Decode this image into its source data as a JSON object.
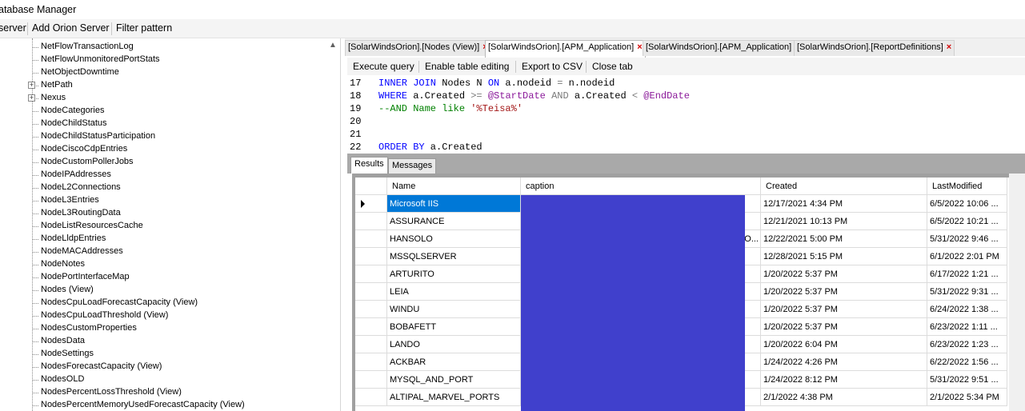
{
  "window": {
    "title": "atabase Manager"
  },
  "toolbar": {
    "items": [
      "server",
      "Add Orion Server",
      "Filter pattern"
    ]
  },
  "tree": {
    "items": [
      {
        "label": "NetFlowTransactionLog",
        "expandable": false
      },
      {
        "label": "NetFlowUnmonitoredPortStats",
        "expandable": false
      },
      {
        "label": "NetObjectDowntime",
        "expandable": false
      },
      {
        "label": "NetPath",
        "expandable": true
      },
      {
        "label": "Nexus",
        "expandable": true
      },
      {
        "label": "NodeCategories",
        "expandable": false
      },
      {
        "label": "NodeChildStatus",
        "expandable": false
      },
      {
        "label": "NodeChildStatusParticipation",
        "expandable": false
      },
      {
        "label": "NodeCiscoCdpEntries",
        "expandable": false
      },
      {
        "label": "NodeCustomPollerJobs",
        "expandable": false
      },
      {
        "label": "NodeIPAddresses",
        "expandable": false
      },
      {
        "label": "NodeL2Connections",
        "expandable": false
      },
      {
        "label": "NodeL3Entries",
        "expandable": false
      },
      {
        "label": "NodeL3RoutingData",
        "expandable": false
      },
      {
        "label": "NodeListResourcesCache",
        "expandable": false
      },
      {
        "label": "NodeLldpEntries",
        "expandable": false
      },
      {
        "label": "NodeMACAddresses",
        "expandable": false
      },
      {
        "label": "NodeNotes",
        "expandable": false
      },
      {
        "label": "NodePortInterfaceMap",
        "expandable": false
      },
      {
        "label": "Nodes (View)",
        "expandable": false
      },
      {
        "label": "NodesCpuLoadForecastCapacity (View)",
        "expandable": false
      },
      {
        "label": "NodesCpuLoadThreshold (View)",
        "expandable": false
      },
      {
        "label": "NodesCustomProperties",
        "expandable": false
      },
      {
        "label": "NodesData",
        "expandable": false
      },
      {
        "label": "NodeSettings",
        "expandable": false
      },
      {
        "label": "NodesForecastCapacity (View)",
        "expandable": false
      },
      {
        "label": "NodesOLD",
        "expandable": false
      },
      {
        "label": "NodesPercentLossThreshold (View)",
        "expandable": false
      },
      {
        "label": "NodesPercentMemoryUsedForecastCapacity (View)",
        "expandable": false
      }
    ],
    "scroll_icon": "chevron-up-icon",
    "expand_glyph": "+"
  },
  "tabs": [
    {
      "label": "[SolarWindsOrion].[Nodes (View)]",
      "active": false
    },
    {
      "label": "[SolarWindsOrion].[APM_Application]",
      "active": true
    },
    {
      "label": "[SolarWindsOrion].[APM_Application]",
      "active": false
    },
    {
      "label": "[SolarWindsOrion].[ReportDefinitions]",
      "active": false
    }
  ],
  "tab_close_glyph": "×",
  "query_toolbar": {
    "execute": "Execute query",
    "enable_edit": "Enable table editing",
    "export_csv": "Export to CSV",
    "close_tab": "Close tab"
  },
  "editor": {
    "lines": [
      {
        "n": "17",
        "tokens": [
          [
            "kw",
            "INNER JOIN"
          ],
          [
            "t",
            " Nodes N "
          ],
          [
            "kw",
            "ON"
          ],
          [
            "t",
            " a.nodeid "
          ],
          [
            "op",
            "="
          ],
          [
            "t",
            " n.nodeid"
          ]
        ]
      },
      {
        "n": "18",
        "tokens": [
          [
            "kw",
            "WHERE"
          ],
          [
            "t",
            " a.Created "
          ],
          [
            "op",
            ">="
          ],
          [
            "t",
            " "
          ],
          [
            "var",
            "@StartDate"
          ],
          [
            "t",
            " "
          ],
          [
            "op",
            "AND"
          ],
          [
            "t",
            " a.Created "
          ],
          [
            "op",
            "<"
          ],
          [
            "t",
            " "
          ],
          [
            "var",
            "@EndDate"
          ]
        ]
      },
      {
        "n": "19",
        "tokens": [
          [
            "cmt",
            "--AND Name like "
          ],
          [
            "str",
            "'%Teisa%'"
          ]
        ]
      },
      {
        "n": "20",
        "tokens": []
      },
      {
        "n": "21",
        "tokens": []
      },
      {
        "n": "22",
        "tokens": [
          [
            "kw",
            "ORDER BY"
          ],
          [
            "t",
            " a.Created"
          ]
        ]
      }
    ]
  },
  "result_tabs": [
    {
      "label": "Results",
      "active": true
    },
    {
      "label": "Messages",
      "active": false
    }
  ],
  "grid": {
    "columns": [
      "Name",
      "caption",
      "Created",
      "LastModified"
    ],
    "current_row_icon": "row-pointer-icon",
    "rows": [
      {
        "name": "Microsoft IIS",
        "caption": "",
        "created": "12/17/2021 4:34 PM",
        "modified": "6/5/2022 10:06 ...",
        "selected": true
      },
      {
        "name": "ASSURANCE",
        "caption": "",
        "created": "12/21/2021 10:13 PM",
        "modified": "6/5/2022 10:21 ..."
      },
      {
        "name": "HANSOLO",
        "caption": "O...",
        "created": "12/22/2021 5:00 PM",
        "modified": "5/31/2022 9:46 ..."
      },
      {
        "name": "MSSQLSERVER",
        "caption": "",
        "created": "12/28/2021 5:15 PM",
        "modified": "6/1/2022 2:01 PM"
      },
      {
        "name": "ARTURITO",
        "caption": "",
        "created": "1/20/2022 5:37 PM",
        "modified": "6/17/2022 1:21 ..."
      },
      {
        "name": "LEIA",
        "caption": "",
        "created": "1/20/2022 5:37 PM",
        "modified": "5/31/2022 9:31 ..."
      },
      {
        "name": "WINDU",
        "caption": "",
        "created": "1/20/2022 5:37 PM",
        "modified": "6/24/2022 1:38 ..."
      },
      {
        "name": "BOBAFETT",
        "caption": "",
        "created": "1/20/2022 5:37 PM",
        "modified": "6/23/2022 1:11 ..."
      },
      {
        "name": "LANDO",
        "caption": "",
        "created": "1/20/2022 6:04 PM",
        "modified": "6/23/2022 1:23 ..."
      },
      {
        "name": "ACKBAR",
        "caption": "",
        "created": "1/24/2022 4:26 PM",
        "modified": "6/22/2022 1:56 ..."
      },
      {
        "name": "MYSQL_AND_PORT",
        "caption": "",
        "created": "1/24/2022 8:12 PM",
        "modified": "5/31/2022 9:51 ..."
      },
      {
        "name": "ALTIPAL_MARVEL_PORTS",
        "caption": "",
        "created": "2/1/2022 4:38 PM",
        "modified": "2/1/2022 5:34 PM"
      }
    ]
  },
  "colors": {
    "redaction": "#4040cc",
    "selection": "#0078d7",
    "tab_close": "#d40000"
  }
}
